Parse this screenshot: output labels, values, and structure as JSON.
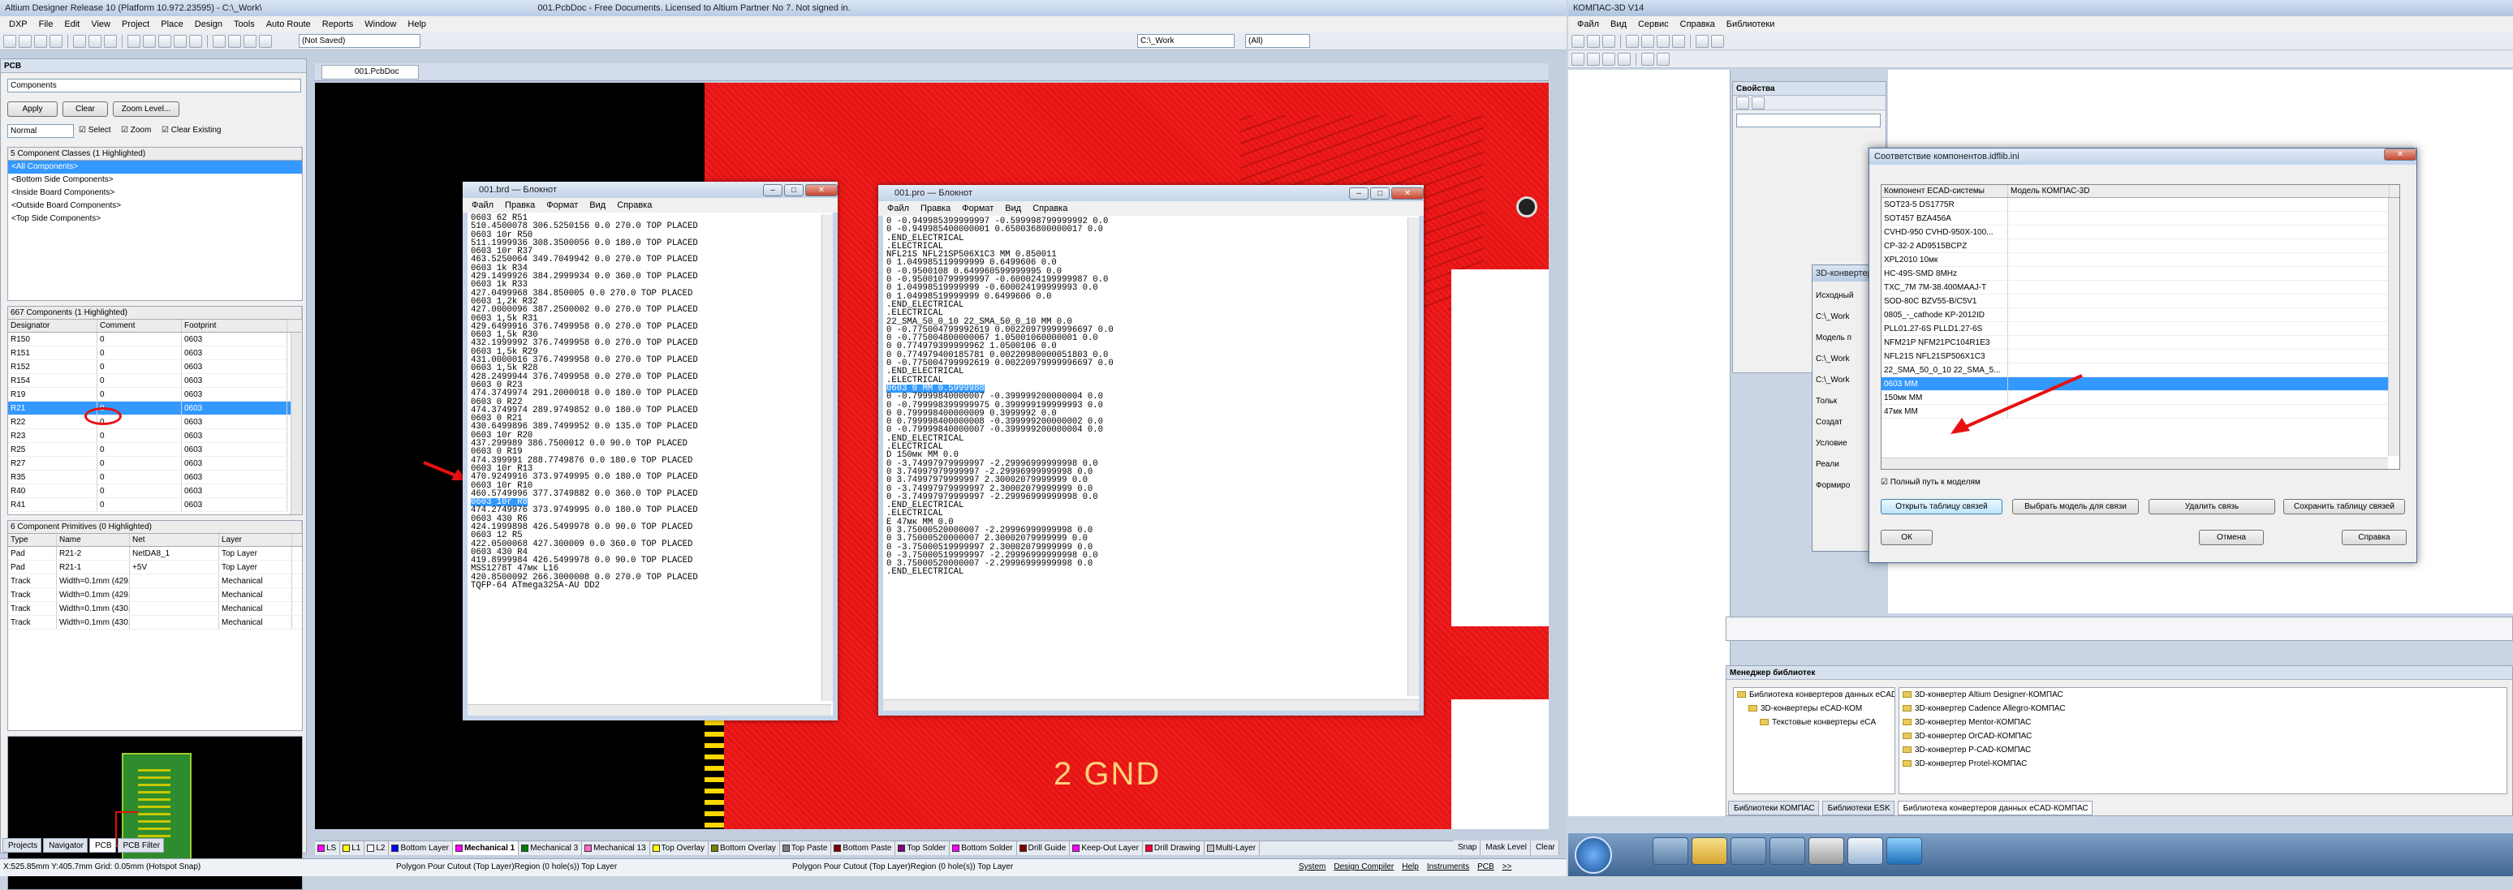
{
  "altium": {
    "title": "Altium Designer Release 10 (Platform 10.972.23595) - C:\\_Work\\",
    "title_right": "001.PcbDoc - Free Documents. Licensed to Altium Partner No 7. Not signed in.",
    "menu": [
      "DXP",
      "File",
      "Edit",
      "View",
      "Project",
      "Place",
      "Design",
      "Tools",
      "Auto Route",
      "Reports",
      "Window",
      "Help"
    ],
    "path_combo": "C:\\_Work",
    "all_combo": "(All)",
    "not_saved": "(Not Saved)",
    "doc_tab": "001.PcbDoc",
    "panel": {
      "title": "PCB",
      "mode": "Components",
      "apply": "Apply",
      "clear": "Clear",
      "zoom_level": "Zoom Level...",
      "mask_mode": "Normal",
      "chk_select": "Select",
      "chk_zoom": "Zoom",
      "chk_clear": "Clear Existing",
      "classes_header": "5 Component Classes (1 Highlighted)",
      "classes": [
        "<All Components>",
        "<Bottom Side Components>",
        "<Inside Board Components>",
        "<Outside Board Components>",
        "<Top Side Components>"
      ],
      "components_header": "667 Components (1 Highlighted)",
      "comp_cols": [
        "Designator",
        "Comment",
        "Footprint"
      ],
      "components": [
        [
          "R150",
          "0",
          "0603"
        ],
        [
          "R151",
          "0",
          "0603"
        ],
        [
          "R152",
          "0",
          "0603"
        ],
        [
          "R154",
          "0",
          "0603"
        ],
        [
          "R19",
          "0",
          "0603"
        ],
        [
          "R21",
          "0",
          "0603"
        ],
        [
          "R22",
          "0",
          "0603"
        ],
        [
          "R23",
          "0",
          "0603"
        ],
        [
          "R25",
          "0",
          "0603"
        ],
        [
          "R27",
          "0",
          "0603"
        ],
        [
          "R35",
          "0",
          "0603"
        ],
        [
          "R40",
          "0",
          "0603"
        ],
        [
          "R41",
          "0",
          "0603"
        ]
      ],
      "primitives_header": "6 Component Primitives (0 Highlighted)",
      "prim_cols": [
        "Type",
        "Name",
        "Net",
        "Layer"
      ],
      "primitives": [
        [
          "Pad",
          "R21-2",
          "NetDA8_1",
          "Top Layer"
        ],
        [
          "Pad",
          "R21-1",
          "+5V",
          "Top Layer"
        ],
        [
          "Track",
          "Width=0.1mm (429.801m",
          "",
          "Mechanical"
        ],
        [
          "Track",
          "Width=0.1mm (429.801m",
          "",
          "Mechanical"
        ],
        [
          "Track",
          "Width=0.1mm (430.367m",
          "",
          "Mechanical"
        ],
        [
          "Track",
          "Width=0.1mm (430.933m",
          "",
          "Mechanical"
        ]
      ],
      "bottom_tabs": [
        "Projects",
        "Navigator",
        "PCB",
        "PCB Filter"
      ]
    },
    "layers": [
      "LS",
      "L1",
      "L2",
      "Bottom Layer",
      "Mechanical 1",
      "Mechanical 3",
      "Mechanical 13",
      "Top Overlay",
      "Bottom Overlay",
      "Top Paste",
      "Bottom Paste",
      "Top Solder",
      "Bottom Solder",
      "Drill Guide",
      "Keep-Out Layer",
      "Drill Drawing",
      "Multi-Layer"
    ],
    "layer_colors": [
      "#ff00ff",
      "#ffff00",
      "#ffffff",
      "#0000ff",
      "#ff00ff",
      "#008000",
      "#ff66cc",
      "#ffff00",
      "#808000",
      "#808080",
      "#800000",
      "#800080",
      "#ff00ff",
      "#800000",
      "#ff00ff",
      "#ff0033",
      "#c0c0c0"
    ],
    "right_tabs": [
      "Snap",
      "Mask Level",
      "Clear"
    ],
    "status_left": "X:525.85mm Y:405.7mm   Grid: 0.05mm     (Hotspot Snap)",
    "status_mid": "Polygon Pour Cutout (Top Layer)Region (0 hole(s)) Top Layer",
    "status_mid2": "Polygon Pour Cutout (Top Layer)Region (0 hole(s)) Top Layer",
    "status_tabs": [
      "System",
      "Design Compiler",
      "Help",
      "Instruments",
      "PCB",
      ">>"
    ],
    "pcb_text": "2 GND"
  },
  "notepad1": {
    "title": "001.brd — Блокнот",
    "menu": [
      "Файл",
      "Правка",
      "Формат",
      "Вид",
      "Справка"
    ],
    "lines": [
      "0603 62 R51",
      "510.4500078 306.5250156 0.0 270.0 TOP PLACED",
      "0603 10r R50",
      "511.1999936 308.3500056 0.0 180.0 TOP PLACED",
      "0603 10r R37",
      "463.5250064 349.7049942 0.0 270.0 TOP PLACED",
      "0603 1k R34",
      "429.1499926 384.2999934 0.0 360.0 TOP PLACED",
      "0603 1k R33",
      "427.0499968 384.850005 0.0 270.0 TOP PLACED",
      "0603 1,2k R32",
      "427.0000096 387.2500002 0.0 270.0 TOP PLACED",
      "0603 1,5k R31",
      "429.6499916 376.7499958 0.0 270.0 TOP PLACED",
      "0603 1,5k R30",
      "432.1999992 376.7499958 0.0 270.0 TOP PLACED",
      "0603 1,5k R29",
      "431.0000016 376.7499958 0.0 270.0 TOP PLACED",
      "0603 1,5k R28",
      "428.2499944 376.7499958 0.0 270.0 TOP PLACED",
      "0603 0 R23",
      "474.3749974 291.2000018 0.0 180.0 TOP PLACED",
      "0603 0 R22",
      "474.3749974 289.9749852 0.0 180.0 TOP PLACED",
      "0603 0 R21",
      "430.6499896 389.7499952 0.0 135.0 TOP PLACED",
      "0603 10r R20",
      "437.299989 386.7500012 0.0 90.0 TOP PLACED",
      "0603 0 R19",
      "474.399991 288.7749876 0.0 180.0 TOP PLACED",
      "0603 10r R13",
      "470.9249916 373.9749995 0.0 180.0 TOP PLACED",
      "0603 10r R10",
      "460.5749996 377.3749882 0.0 360.0 TOP PLACED",
      "0603 10r R8",
      "474.2749976 373.9749995 0.0 180.0 TOP PLACED",
      "0603 430 R6",
      "424.1999898 426.5499978 0.0 90.0 TOP PLACED",
      "0603 12 R5",
      "422.0500068 427.300009 0.0 360.0 TOP PLACED",
      "0603 430 R4",
      "419.8999984 426.5499978 0.0 90.0 TOP PLACED",
      "MSS1278T 47мк L16",
      "420.8500092 266.3000008 0.0 270.0 TOP PLACED",
      "TQFP-64 ATmega325A-AU DD2"
    ],
    "highlight_line": 34
  },
  "notepad2": {
    "title": "001.pro — Блокнот",
    "menu": [
      "Файл",
      "Правка",
      "Формат",
      "Вид",
      "Справка"
    ],
    "lines": [
      "0 -0.949985399999997 -0.599998799999992 0.0",
      "0 -0.949985400000001 0.650036800000017 0.0",
      ".END_ELECTRICAL",
      ".ELECTRICAL",
      "NFL21S NFL21SP506X1C3 MM 0.850011",
      "0 1.049985119999999 0.6499606 0.0",
      "0 -0.9500108 0.649960599999995 0.0",
      "0 -0.950010799999997 -0.600024199999987 0.0",
      "0 1.04998519999999 -0.600024199999993 0.0",
      "0 1.04998519999999 0.6499606 0.0",
      ".END_ELECTRICAL",
      ".ELECTRICAL",
      "22_SMA_50_0_10 22_SMA_50_0_10 MM 0.0",
      "0 -0.775004799992619 0.00220979999996697 0.0",
      "0 -0.775004800000067 1.05001060000001 0.0",
      "0 0.774979399999962 1.0500106 0.0",
      "0 0.774979400185781 0.00220980000051803 0.0",
      "0 -0.775004799992619 0.00220979999996697 0.0",
      ".END_ELECTRICAL",
      ".ELECTRICAL",
      "0603 0 MM 0.5999988",
      "0 -0.79999840000007 -0.399999200000004 0.0",
      "0 -0.799998399999975 0.399999199999993 0.0",
      "0 0.799998400000009 0.3999992 0.0",
      "0 0.799998400000008 -0.399999200000002 0.0",
      "0 -0.79999840000007 -0.399999200000004 0.0",
      ".END_ELECTRICAL",
      ".ELECTRICAL",
      "D 150мк MM 0.0",
      "0 -3.74997979999997 -2.29996999999998 0.0",
      "0 3.74997979999997 -2.29996999999998 0.0",
      "0 3.74997979999997 2.30002079999999 0.0",
      "0 -3.74997979999997 2.30002079999999 0.0",
      "0 -3.74997979999997 -2.29996999999998 0.0",
      ".END_ELECTRICAL",
      ".ELECTRICAL",
      "E 47мк MM 0.0",
      "0 3.75000520000007 -2.29996999999998 0.0",
      "0 3.75000520000007 2.30002079999999 0.0",
      "0 -3.75000519999997 2.30002079999999 0.0",
      "0 -3.75000519999997 -2.29996999999998 0.0",
      "0 3.75000520000007 -2.29996999999998 0.0",
      ".END_ELECTRICAL"
    ],
    "highlight_line": 20
  },
  "kompas": {
    "title": "КОМПАС-3D V14",
    "menu": [
      "Файл",
      "Вид",
      "Сервис",
      "Справка",
      "Библиотеки"
    ],
    "props": "Свойства",
    "dialog": {
      "title": "Соответствие компонентов.idflib.ini",
      "col1": "Компонент ECAD-системы",
      "col2": "Модель КОМПАС-3D",
      "items": [
        "SOT23-5 DS1775R",
        "SOT457 BZA456A",
        "CVHD-950 CVHD-950X-100...",
        "CP-32-2 AD9515BCPZ",
        "XPL2010 10мк",
        "HC-49S-SMD 8MHz",
        "TXC_7M 7M-38.400MAAJ-T",
        "SOD-80C BZV55-B/C5V1",
        "0805_-_cathode KP-2012ID",
        "PLL01.27-6S PLLD1.27-6S",
        "NFM21P NFM21PC104R1E3",
        "NFL21S NFL21SP506X1C3",
        "22_SMA_50_0_10 22_SMA_5...",
        "0603 MM",
        "150мк MM",
        "47мк MM"
      ],
      "selected_index": 13,
      "chk_full_path": "Полный путь к моделям",
      "btn_open": "Открыть таблицу связей",
      "btn_choose": "Выбрать модель для связи",
      "btn_delete": "Удалить связь",
      "btn_save": "Сохранить таблицу связей",
      "btn_ok": "ОК",
      "btn_cancel": "Отмена",
      "btn_help": "Справка"
    },
    "behind_dialog": {
      "title": "3D-конвертер",
      "labels": [
        "Исходный",
        "C:\\_Work",
        "Модель п",
        "C:\\_Work",
        "C:\\_Work",
        "Тольк",
        "Создат",
        "Условие",
        "Реали",
        "Формиро"
      ]
    },
    "libmgr": {
      "title": "Менеджер библиотек",
      "tree": [
        "Библиотека конвертеров данных eCAD-КОМПАС",
        "3D-конвертеры eCAD-КОМ",
        "Текстовые конвертеры eCA"
      ],
      "list": [
        "3D-конвертер Altium Designer-КОМПАС",
        "3D-конвертер Cadence Allegro-КОМПАС",
        "3D-конвертер Mentor-КОМПАС",
        "3D-конвертер OrCAD-КОМПАС",
        "3D-конвертер P-CAD-КОМПАС",
        "3D-конвертер Protel-КОМПАС"
      ],
      "tabs": [
        "Библиотеки КОМПАС",
        "Библиотеки ESK",
        "Библиотека конвертеров данных eCAD-КОМПАС"
      ]
    }
  }
}
